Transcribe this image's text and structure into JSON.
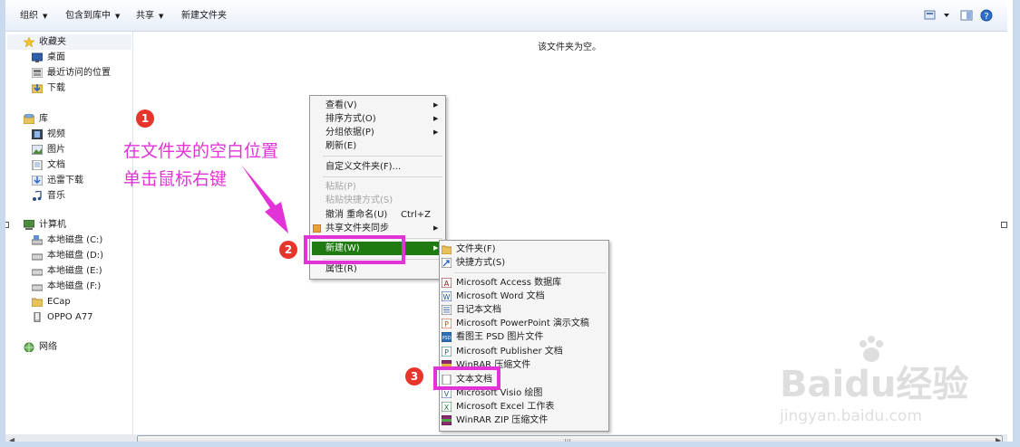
{
  "toolbar": {
    "organize": "组织",
    "include_in_library": "包含到库中",
    "share": "共享",
    "new_folder": "新建文件夹"
  },
  "nav": {
    "favorites": "收藏夹",
    "desktop": "桌面",
    "recent": "最近访问的位置",
    "downloads": "下载",
    "library": "库",
    "videos": "视频",
    "pictures": "图片",
    "documents": "文档",
    "xunlei": "迅雷下载",
    "music": "音乐",
    "computer": "计算机",
    "disk_c": "本地磁盘 (C:)",
    "disk_d": "本地磁盘 (D:)",
    "disk_e": "本地磁盘 (E:)",
    "disk_f": "本地磁盘 (F:)",
    "ecap": "ECap",
    "oppo": "OPPO A77",
    "network": "网络"
  },
  "content": {
    "empty_message": "该文件夹为空。"
  },
  "context_menu": {
    "view": "查看(V)",
    "sort_by": "排序方式(O)",
    "group_by": "分组依据(P)",
    "refresh": "刷新(E)",
    "customize": "自定义文件夹(F)...",
    "paste": "粘贴(P)",
    "paste_shortcut": "粘贴快捷方式(S)",
    "undo_rename": "撤消 重命名(U)",
    "undo_shortcut": "Ctrl+Z",
    "share_sync": "共享文件夹同步",
    "new": "新建(W)",
    "properties": "属性(R)"
  },
  "new_submenu": {
    "folder": "文件夹(F)",
    "shortcut": "快捷方式(S)",
    "access": "Microsoft Access 数据库",
    "word": "Microsoft Word 文档",
    "journal": "日记本文档",
    "powerpoint": "Microsoft PowerPoint 演示文稿",
    "psd": "看图王 PSD 图片文件",
    "publisher": "Microsoft Publisher 文档",
    "winrar": "WinRAR 压缩文件",
    "text": "文本文档",
    "visio": "Microsoft Visio 绘图",
    "excel": "Microsoft Excel 工作表",
    "winrar_zip": "WinRAR ZIP 压缩文件"
  },
  "annotations": {
    "step1": "1",
    "step2": "2",
    "step3": "3",
    "instruction_line1": "在文件夹的空白位置",
    "instruction_line2": "单击鼠标右键"
  },
  "watermark": {
    "main": "Baidu经验",
    "sub": "jingyan.baidu.com"
  },
  "colors": {
    "accent_pink": "#e233d6",
    "badge_red": "#e8352c",
    "highlight_green": "#1f7a12"
  }
}
